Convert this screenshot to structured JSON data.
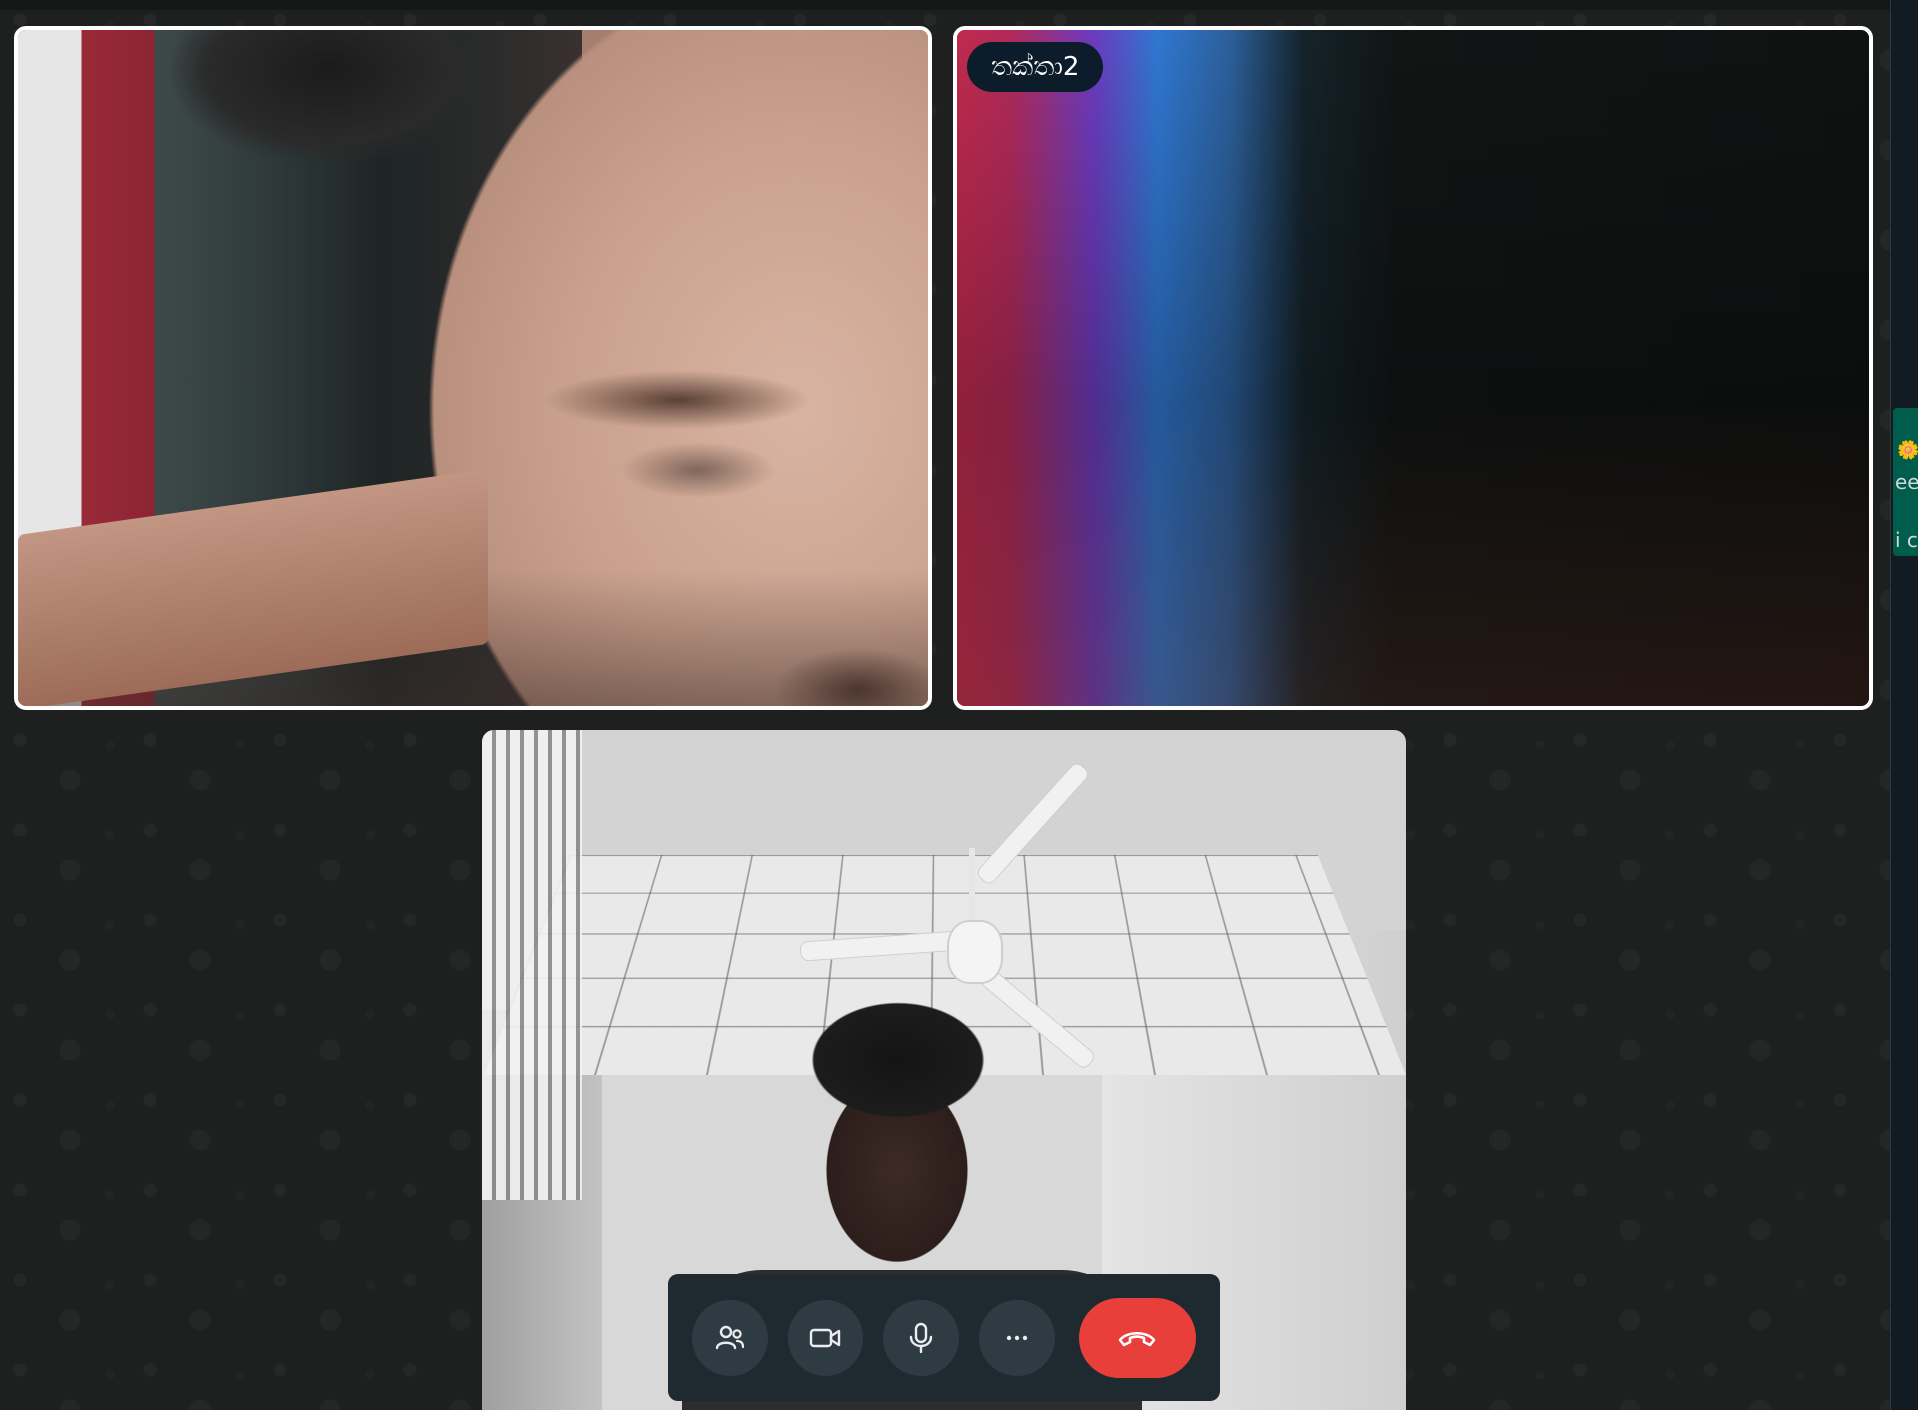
{
  "participants": [
    {
      "id": "remote-1",
      "name": ""
    },
    {
      "id": "remote-2",
      "name": "තක්තා2"
    }
  ],
  "controls": {
    "participants_icon": "people-icon",
    "video_icon": "video-camera-icon",
    "mic_icon": "microphone-icon",
    "more_icon": "more-options-icon",
    "end_call_icon": "end-call-icon",
    "end_call_color": "#e83f3a"
  },
  "side_panel": {
    "emoji": "🌼",
    "snippet_1": "ee",
    "snippet_2": "i c"
  }
}
